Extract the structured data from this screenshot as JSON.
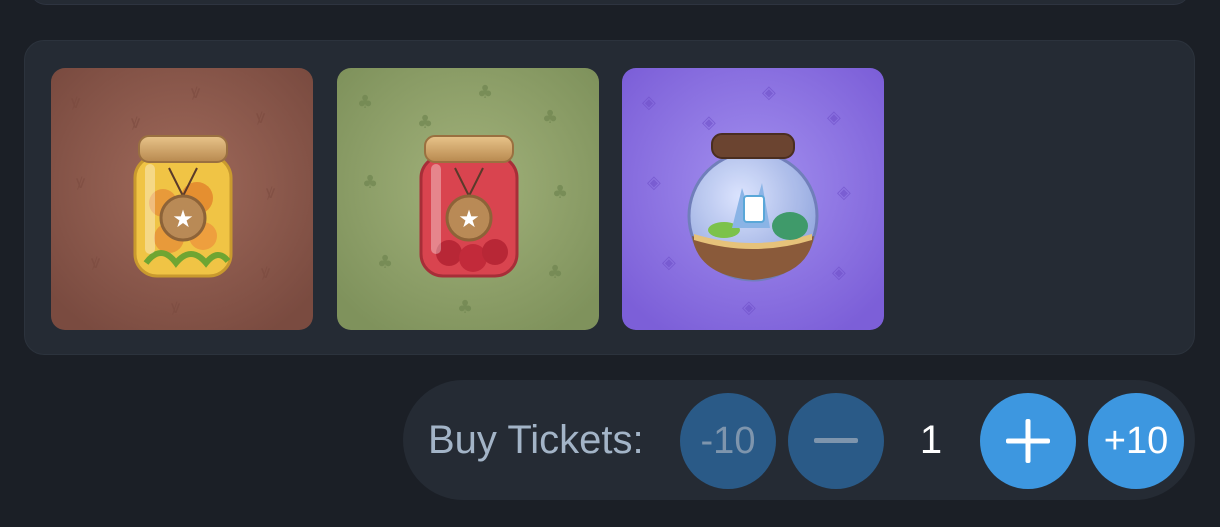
{
  "prizes": [
    {
      "icon": "pickle-jar-icon",
      "bg": "#8e5a4d"
    },
    {
      "icon": "cherry-jam-jar-icon",
      "bg": "#8b9e67"
    },
    {
      "icon": "terrarium-icon",
      "bg": "#8a6de0"
    }
  ],
  "tickets": {
    "label": "Buy Tickets:",
    "minus10": "-10",
    "quantity": "1",
    "plus10": "+10"
  },
  "colors": {
    "background": "#1b1f26",
    "card": "#252b34",
    "button_active": "#3d97e0",
    "button_disabled": "#2a5a87"
  }
}
